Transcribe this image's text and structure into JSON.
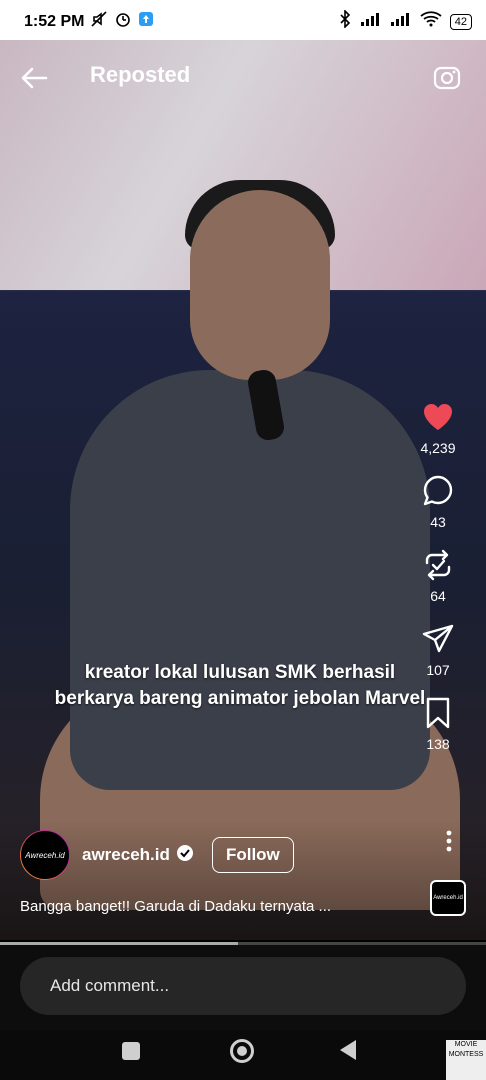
{
  "status": {
    "time": "1:52 PM",
    "battery": "42",
    "icons": [
      "mute-icon",
      "alarm-icon",
      "app-notification-icon",
      "bluetooth-icon",
      "signal-icon",
      "signal-icon-2",
      "wifi-icon"
    ]
  },
  "header": {
    "title": "Reposted",
    "back_icon": "arrow-left-icon",
    "camera_icon": "camera-icon"
  },
  "video": {
    "caption_line1": "kreator lokal lulusan SMK berhasil",
    "caption_line2": "berkarya bareng animator jebolan Marvel"
  },
  "actions": {
    "like_count": "4,239",
    "comment_count": "43",
    "repost_count": "64",
    "share_count": "107",
    "save_count": "138",
    "like_color": "#ed4956"
  },
  "author": {
    "avatar_text": "Awreceh.id",
    "username": "awreceh.id",
    "follow_label": "Follow",
    "description": "Bangga banget!! Garuda di Dadaku ternyata ..."
  },
  "audio": {
    "thumb_text": "Awreceh.id"
  },
  "progress": 0.49,
  "comment": {
    "placeholder": "Add comment..."
  },
  "watermark": {
    "text": "MOVIE MONTESS"
  }
}
